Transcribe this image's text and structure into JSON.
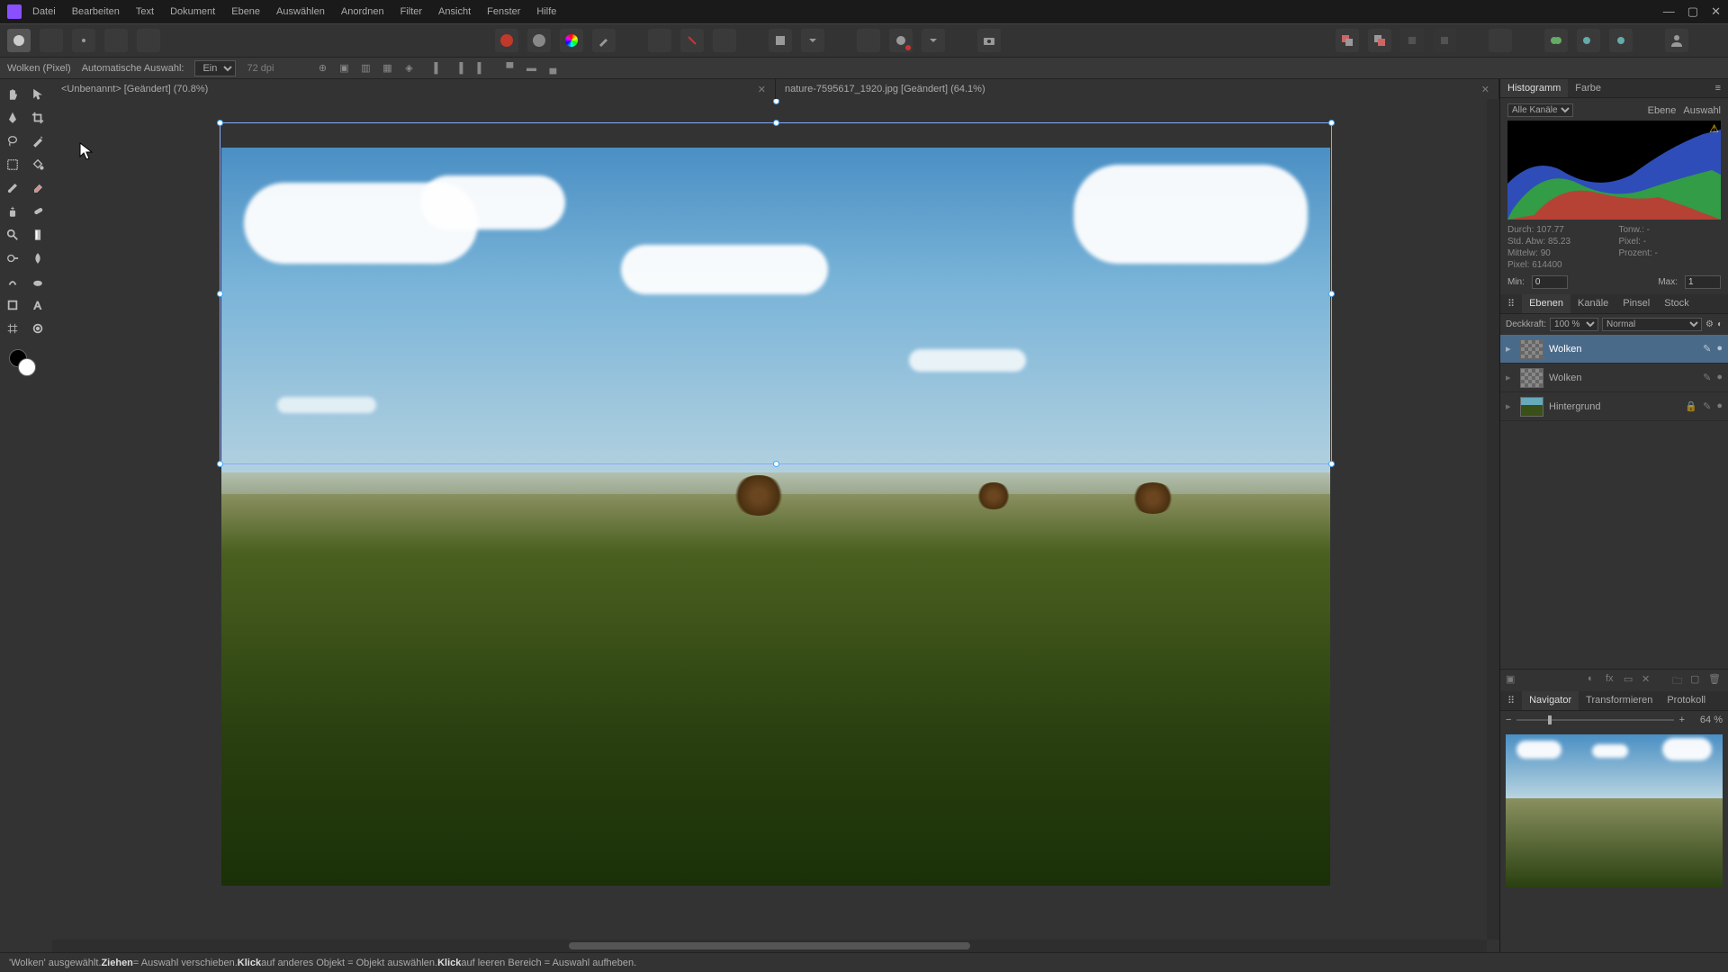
{
  "menu": [
    "Datei",
    "Bearbeiten",
    "Text",
    "Dokument",
    "Ebene",
    "Auswählen",
    "Anordnen",
    "Filter",
    "Ansicht",
    "Fenster",
    "Hilfe"
  ],
  "context": {
    "tool_label": "Wolken (Pixel)",
    "auto_select_label": "Automatische Auswahl:",
    "auto_select_value": "Ein",
    "dpi": "72 dpi"
  },
  "tabs": [
    {
      "title": "<Unbenannt> [Geändert] (70.8%)",
      "active": false
    },
    {
      "title": "nature-7595617_1920.jpg [Geändert] (64.1%)",
      "active": true
    }
  ],
  "histogram": {
    "tabs": [
      "Histogramm",
      "Farbe"
    ],
    "channel_label": "Alle Kanäle",
    "scope": [
      "Ebene",
      "Auswahl"
    ],
    "stats": {
      "durch_label": "Durch:",
      "durch": "107.77",
      "std_label": "Std. Abw:",
      "std": "85.23",
      "mittelw_label": "Mittelw:",
      "mittelw": "90",
      "pixel_label": "Pixel:",
      "pixel": "614400",
      "tonw_label": "Tonw.:",
      "tonw": "-",
      "pixel2_label": "Pixel:",
      "pixel2": "-",
      "prozent_label": "Prozent:",
      "prozent": "-"
    },
    "min_label": "Min:",
    "min_value": "0",
    "max_label": "Max:",
    "max_value": "1"
  },
  "layers": {
    "tabs": [
      "Ebenen",
      "Kanäle",
      "Pinsel",
      "Stock"
    ],
    "opacity_label": "Deckkraft:",
    "opacity_value": "100 %",
    "blend_mode": "Normal",
    "items": [
      {
        "name": "Wolken",
        "selected": true,
        "locked": false,
        "checker": true
      },
      {
        "name": "Wolken",
        "selected": false,
        "locked": false,
        "checker": true
      },
      {
        "name": "Hintergrund",
        "selected": false,
        "locked": true,
        "checker": false
      }
    ]
  },
  "navigator": {
    "tabs": [
      "Navigator",
      "Transformieren",
      "Protokoll"
    ],
    "zoom": "64 %"
  },
  "status": {
    "parts": [
      {
        "t": "'Wolken' ausgewählt. "
      },
      {
        "b": "Ziehen"
      },
      {
        "t": " = Auswahl verschieben. "
      },
      {
        "b": "Klick"
      },
      {
        "t": " auf anderes Objekt = Objekt auswählen. "
      },
      {
        "b": "Klick"
      },
      {
        "t": " auf leeren Bereich = Auswahl aufheben."
      }
    ]
  }
}
